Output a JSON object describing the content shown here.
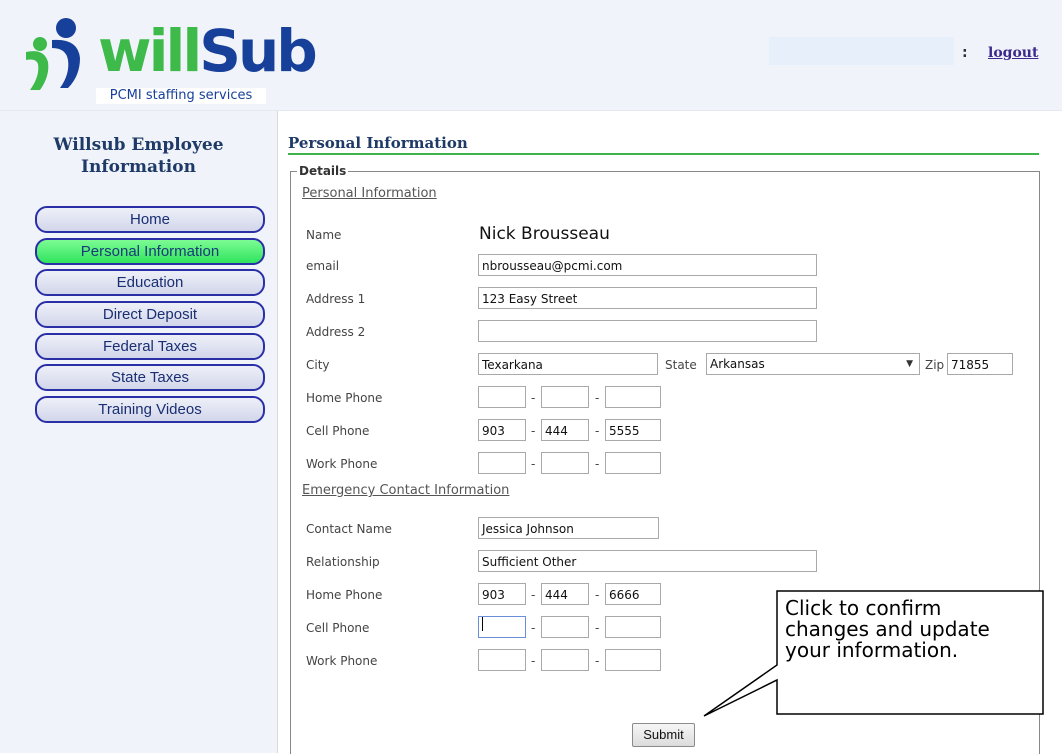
{
  "header": {
    "logo": {
      "brand": "willSub",
      "tagline": "PCMI staffing services"
    },
    "separator": ":",
    "logout_label": "logout"
  },
  "sidebar": {
    "title": "Willsub Employee Information",
    "items": [
      {
        "label": "Home",
        "active": false
      },
      {
        "label": "Personal Information",
        "active": true
      },
      {
        "label": "Education",
        "active": false
      },
      {
        "label": "Direct Deposit",
        "active": false
      },
      {
        "label": "Federal Taxes",
        "active": false
      },
      {
        "label": "State Taxes",
        "active": false
      },
      {
        "label": "Training Videos",
        "active": false
      }
    ]
  },
  "main": {
    "page_title": "Personal Information",
    "fieldset_legend": "Details",
    "personal": {
      "section_title": "Personal Information",
      "name_label": "Name",
      "name_value": "Nick Brousseau",
      "email_label": "email",
      "email_value": "nbrousseau@pcmi.com",
      "address1_label": "Address 1",
      "address1_value": "123 Easy Street",
      "address2_label": "Address 2",
      "address2_value": "",
      "city_label": "City",
      "city_value": "Texarkana",
      "state_label": "State",
      "state_value": "Arkansas",
      "zip_label": "Zip",
      "zip_value": "71855",
      "home_phone_label": "Home Phone",
      "home_phone": [
        "",
        "",
        ""
      ],
      "cell_phone_label": "Cell Phone",
      "cell_phone": [
        "903",
        "444",
        "5555"
      ],
      "work_phone_label": "Work Phone",
      "work_phone": [
        "",
        "",
        ""
      ]
    },
    "emergency": {
      "section_title": "Emergency Contact Information",
      "contact_name_label": "Contact Name",
      "contact_name_value": "Jessica Johnson",
      "relationship_label": "Relationship",
      "relationship_value": "Sufficient Other",
      "home_phone_label": "Home Phone",
      "home_phone": [
        "903",
        "444",
        "6666"
      ],
      "cell_phone_label": "Cell Phone",
      "cell_phone": [
        "",
        "",
        ""
      ],
      "work_phone_label": "Work Phone",
      "work_phone": [
        "",
        "",
        ""
      ]
    },
    "phone_separator": "-",
    "submit_label": "Submit"
  },
  "callout": {
    "lines": [
      "Click to confirm",
      "changes and update",
      "your information."
    ]
  },
  "colors": {
    "accent_green": "#3cb44b",
    "nav_border": "#2a2fa6",
    "nav_active": "#2fe35d",
    "title_navy": "#1e3a66",
    "sidebar_bg": "#f1f3fa"
  }
}
